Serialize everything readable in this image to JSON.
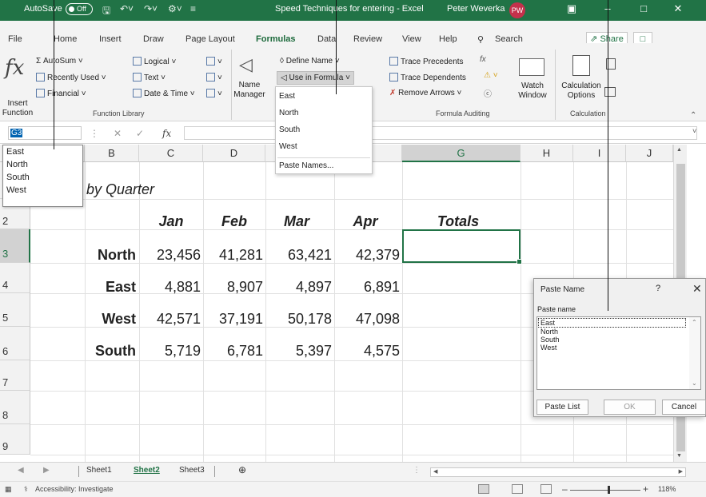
{
  "titlebar": {
    "autosave_label": "AutoSave",
    "autosave_state": "Off",
    "doc_title": "Speed Techniques for entering - Excel",
    "user_name": "Peter Weverka",
    "user_initials": "PW",
    "accent_color": "#217346"
  },
  "tabs": [
    "File",
    "Home",
    "Insert",
    "Draw",
    "Page Layout",
    "Formulas",
    "Data",
    "Review",
    "View",
    "Help"
  ],
  "active_tab": "Formulas",
  "search_label": "Search",
  "share_label": "Share",
  "ribbon": {
    "insert_function": [
      "Insert",
      "Function"
    ],
    "autosum": "AutoSum",
    "recently_used": "Recently Used",
    "financial": "Financial",
    "logical": "Logical",
    "text": "Text",
    "date_time": "Date & Time",
    "name_manager": [
      "Name",
      "Manager"
    ],
    "define_name": "Define Name",
    "use_in_formula": "Use in Formula",
    "trace_precedents": "Trace Precedents",
    "trace_dependents": "Trace Dependents",
    "remove_arrows": "Remove Arrows",
    "watch_window": [
      "Watch",
      "Window"
    ],
    "calc_options": [
      "Calculation",
      "Options"
    ],
    "group_function_library": "Function Library",
    "group_formula_auditing": "Formula Auditing",
    "group_calculation": "Calculation"
  },
  "formula_bar": {
    "name_box": "G3",
    "fx": "fx"
  },
  "name_box_list": [
    "East",
    "North",
    "South",
    "West"
  ],
  "use_in_formula_menu": {
    "items": [
      "East",
      "North",
      "South",
      "West"
    ],
    "paste_names": "Paste Names..."
  },
  "columns": [
    "B",
    "C",
    "D",
    "G",
    "H",
    "I",
    "J"
  ],
  "rows": [
    "2",
    "3",
    "4",
    "5",
    "6",
    "7",
    "8",
    "9"
  ],
  "sheet": {
    "title_fragment": "by Quarter",
    "headers": [
      "Jan",
      "Feb",
      "Mar",
      "Apr",
      "Totals"
    ],
    "data": [
      {
        "label": "North",
        "values": [
          "23,456",
          "41,281",
          "63,421",
          "42,379"
        ]
      },
      {
        "label": "East",
        "values": [
          "4,881",
          "8,907",
          "4,897",
          "6,891"
        ]
      },
      {
        "label": "West",
        "values": [
          "42,571",
          "37,191",
          "50,178",
          "47,098"
        ]
      },
      {
        "label": "South",
        "values": [
          "5,719",
          "6,781",
          "5,397",
          "4,575"
        ]
      }
    ]
  },
  "paste_name_dialog": {
    "title": "Paste Name",
    "help": "?",
    "list_label": "Paste name",
    "names": [
      "East",
      "North",
      "South",
      "West"
    ],
    "paste_list": "Paste List",
    "ok": "OK",
    "cancel": "Cancel"
  },
  "sheet_tabs": [
    "Sheet1",
    "Sheet2",
    "Sheet3"
  ],
  "active_sheet": "Sheet2",
  "status": {
    "accessibility": "Accessibility: Investigate",
    "zoom": "118%"
  }
}
